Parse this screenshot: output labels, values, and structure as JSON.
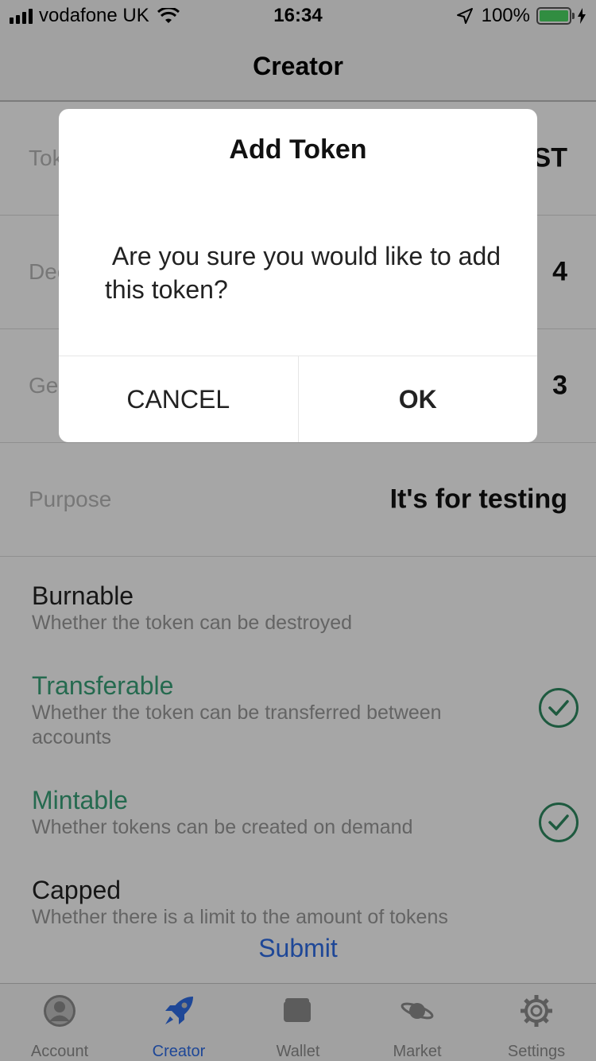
{
  "status": {
    "carrier": "vodafone UK",
    "time": "16:34",
    "battery": "100%"
  },
  "nav": {
    "title": "Creator"
  },
  "fields": [
    {
      "label": "Token",
      "value": "TEST"
    },
    {
      "label": "Decimals",
      "value": "4"
    },
    {
      "label": "Generation",
      "value": "3"
    },
    {
      "label": "Purpose",
      "value": "It's for testing"
    }
  ],
  "options": [
    {
      "title": "Burnable",
      "desc": "Whether the token can be destroyed",
      "enabled": false
    },
    {
      "title": "Transferable",
      "desc": "Whether the token can be transferred between accounts",
      "enabled": true
    },
    {
      "title": "Mintable",
      "desc": "Whether tokens can be created on demand",
      "enabled": true
    },
    {
      "title": "Capped",
      "desc": "Whether there is a limit to the amount of tokens",
      "enabled": false
    }
  ],
  "submit_label": "Submit",
  "tabs": [
    {
      "label": "Account",
      "icon": "account-icon"
    },
    {
      "label": "Creator",
      "icon": "rocket-icon",
      "active": true
    },
    {
      "label": "Wallet",
      "icon": "wallet-icon"
    },
    {
      "label": "Market",
      "icon": "planet-icon"
    },
    {
      "label": "Settings",
      "icon": "gear-icon"
    }
  ],
  "dialog": {
    "title": "Add Token",
    "message": " Are you sure you would like to add this token?",
    "cancel_label": "CANCEL",
    "ok_label": "OK"
  },
  "colors": {
    "accent_blue": "#2f6ee8",
    "enabled_green": "#3aa37a",
    "battery_green": "#4cd964"
  }
}
